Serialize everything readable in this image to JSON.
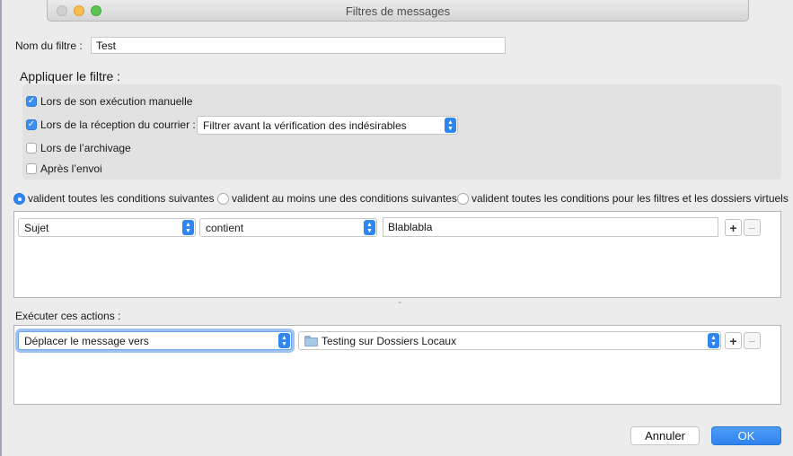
{
  "window": {
    "title": "Filtres de messages"
  },
  "filter_name": {
    "label": "Nom du filtre :",
    "value": "Test"
  },
  "apply": {
    "heading": "Appliquer le filtre :",
    "options": [
      {
        "label": "Lors de son exécution manuelle",
        "checked": true
      },
      {
        "label": "Lors de la réception du courrier :",
        "checked": true
      },
      {
        "label": "Lors de l’archivage",
        "checked": false
      },
      {
        "label": "Après l’envoi",
        "checked": false
      }
    ],
    "reception_timing": "Filtrer avant la vérification des indésirables"
  },
  "match": {
    "options": [
      {
        "label": "valident toutes les conditions suivantes",
        "selected": true
      },
      {
        "label": "valident au moins une des conditions suivantes",
        "selected": false
      },
      {
        "label": "valident toutes les conditions pour les filtres et les dossiers virtuels",
        "selected": false
      }
    ]
  },
  "conditions": [
    {
      "field": "Sujet",
      "operator": "contient",
      "value": "Blablabla",
      "add": "+",
      "remove": "−"
    }
  ],
  "actions": {
    "heading": "Exécuter ces actions :",
    "rows": [
      {
        "action": "Déplacer le message vers",
        "target": "Testing sur Dossiers Locaux",
        "add": "+",
        "remove": "−"
      }
    ]
  },
  "buttons": {
    "cancel": "Annuler",
    "ok": "OK"
  },
  "colors": {
    "accent": "#2f86f3",
    "window_bg": "#ececec"
  }
}
